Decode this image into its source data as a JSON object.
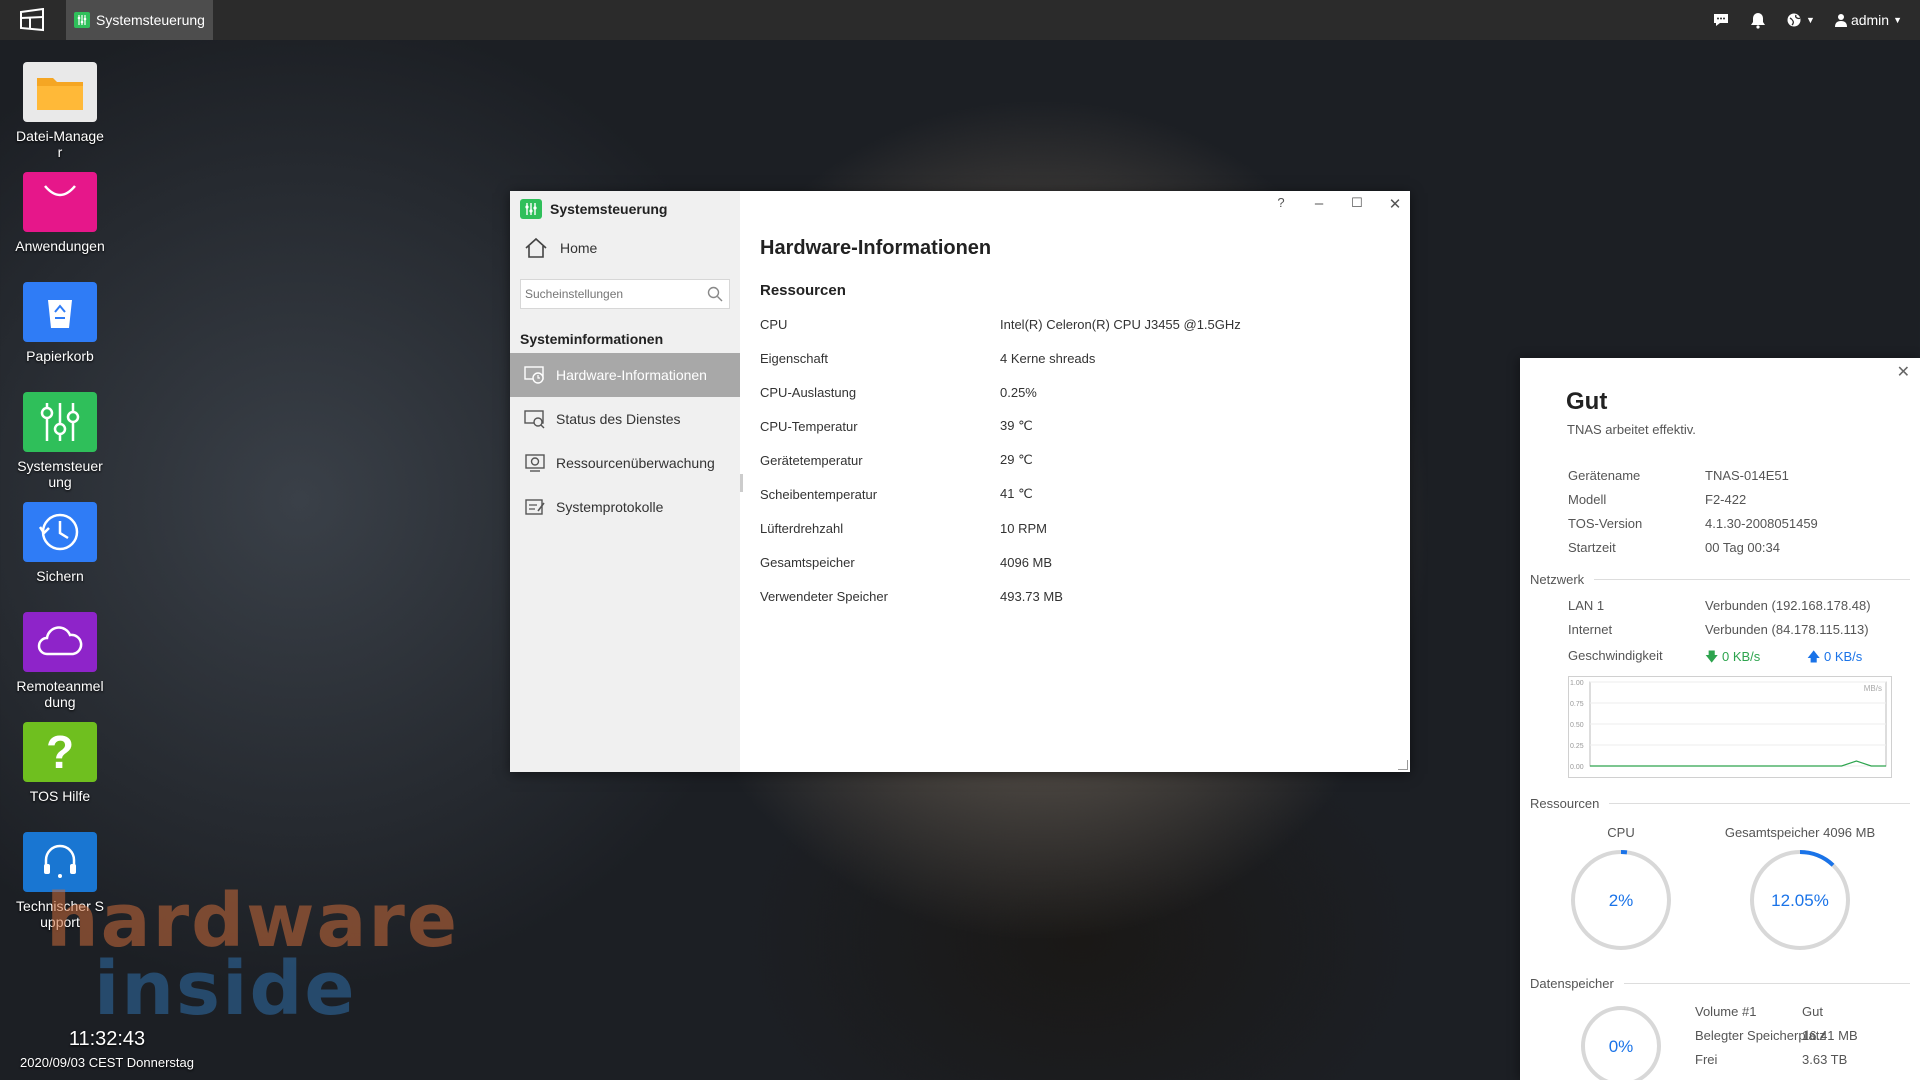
{
  "taskbar": {
    "active_app": "Systemsteuerung",
    "user": "admin",
    "icons": [
      "chat-icon",
      "bell-icon",
      "globe-icon",
      "user-icon"
    ]
  },
  "desktop": {
    "icons": [
      {
        "label": "Datei-Manager",
        "icon": "folder-icon",
        "color": "#f5a623"
      },
      {
        "label": "Anwendungen",
        "icon": "bag-icon",
        "color": "#e6178a"
      },
      {
        "label": "Papierkorb",
        "icon": "recycle-icon",
        "color": "#2f7cf6"
      },
      {
        "label": "Systemsteuerung",
        "icon": "sliders-icon",
        "color": "#2fbf5a"
      },
      {
        "label": "Sichern",
        "icon": "clock-restore-icon",
        "color": "#2f7cf6"
      },
      {
        "label": "Remoteanmeldung",
        "icon": "cloud-icon",
        "color": "#8e24c9"
      },
      {
        "label": "TOS Hilfe",
        "icon": "question-icon",
        "color": "#6fbf1f"
      },
      {
        "label": "Technischer Support",
        "icon": "headset-icon",
        "color": "#1976d2"
      }
    ],
    "clock": {
      "time": "11:32:43",
      "date": "2020/09/03 CEST Donnerstag"
    },
    "watermark": {
      "line1": "hardware",
      "line2": "inside"
    }
  },
  "window": {
    "title": "Systemsteuerung",
    "home_label": "Home",
    "search_placeholder": "Sucheinstellungen",
    "category": "Systeminformationen",
    "nav": [
      {
        "label": "Hardware-Informationen",
        "icon": "hardware-icon",
        "active": true
      },
      {
        "label": "Status des Dienstes",
        "icon": "service-status-icon",
        "active": false
      },
      {
        "label": "Ressourcenüberwachung",
        "icon": "monitor-icon",
        "active": false
      },
      {
        "label": "Systemprotokolle",
        "icon": "log-icon",
        "active": false
      }
    ],
    "controls": {
      "help": "?",
      "minimize": "–",
      "maximize": "☐",
      "close": "✕"
    },
    "heading": "Hardware-Informationen",
    "section": "Ressourcen",
    "rows": [
      {
        "key": "CPU",
        "value": "Intel(R) Celeron(R) CPU J3455 @1.5GHz"
      },
      {
        "key": "Eigenschaft",
        "value": "4 Kerne shreads"
      },
      {
        "key": "CPU-Auslastung",
        "value": "0.25%"
      },
      {
        "key": "CPU-Temperatur",
        "value": "39 ℃"
      },
      {
        "key": "Gerätetemperatur",
        "value": "29 ℃"
      },
      {
        "key": "Scheibentemperatur",
        "value": "41 ℃"
      },
      {
        "key": "Lüfterdrehzahl",
        "value": "10 RPM"
      },
      {
        "key": "Gesamtspeicher",
        "value": "4096 MB"
      },
      {
        "key": "Verwendeter Speicher",
        "value": "493.73 MB"
      }
    ]
  },
  "status_panel": {
    "title": "Gut",
    "subtitle": "TNAS arbeitet effektiv.",
    "device": [
      {
        "key": "Gerätename",
        "value": "TNAS-014E51"
      },
      {
        "key": "Modell",
        "value": "F2-422"
      },
      {
        "key": "TOS-Version",
        "value": "4.1.30-2008051459"
      },
      {
        "key": "Startzeit",
        "value": "00 Tag 00:34"
      }
    ],
    "network_label": "Netzwerk",
    "network": [
      {
        "key": "LAN 1",
        "value": "Verbunden (192.168.178.48)"
      },
      {
        "key": "Internet",
        "value": "Verbunden (84.178.115.113)"
      }
    ],
    "speed_label": "Geschwindigkeit",
    "speed_down": "0 KB/s",
    "speed_up": "0 KB/s",
    "chart": {
      "unit": "MB/s",
      "y_ticks": [
        "1.00",
        "0.75",
        "0.50",
        "0.25",
        "0.00"
      ],
      "ylim": [
        0,
        1
      ],
      "points": [
        0,
        0,
        0,
        0,
        0,
        0,
        0,
        0,
        0,
        0,
        0,
        0,
        0,
        0,
        0,
        0,
        0,
        0,
        0.06,
        0,
        0
      ]
    },
    "resources_label": "Ressourcen",
    "cpu_label": "CPU",
    "cpu_value": "2%",
    "cpu_fraction": 0.02,
    "mem_label": "Gesamtspeicher 4096 MB",
    "mem_value": "12.05%",
    "mem_fraction": 0.1205,
    "storage_label": "Datenspeicher",
    "storage_value": "0%",
    "storage_fraction": 0,
    "storage": [
      {
        "key": "Volume #1",
        "value": "Gut"
      },
      {
        "key": "Belegter Speicherplatz",
        "value": "16.41 MB"
      },
      {
        "key": "Frei",
        "value": "3.63 TB"
      }
    ]
  }
}
